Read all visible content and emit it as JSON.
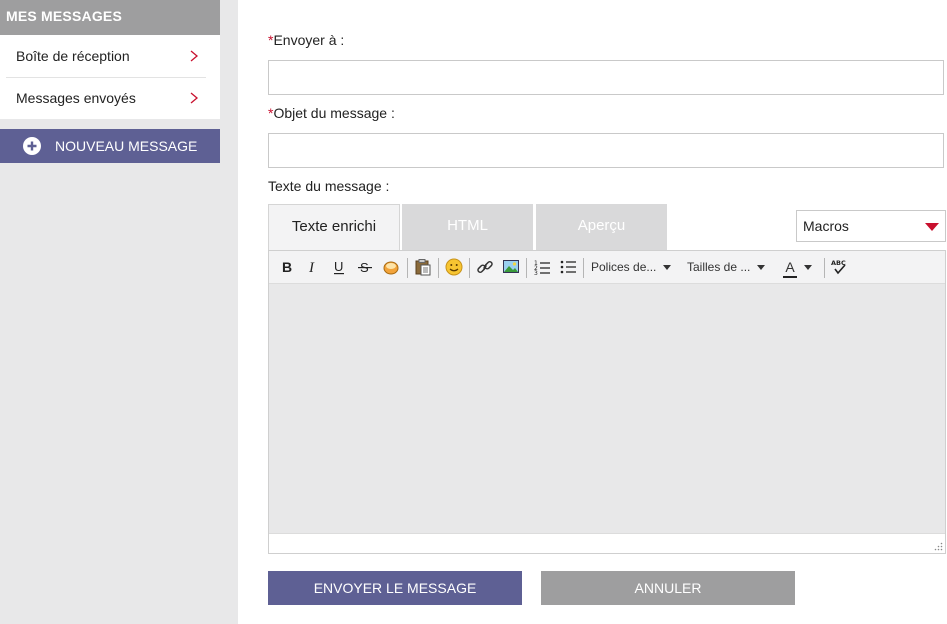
{
  "sidebar": {
    "title": "MES MESSAGES",
    "items": [
      {
        "label": "Boîte de réception"
      },
      {
        "label": "Messages envoyés"
      }
    ],
    "new_message_label": "NOUVEAU MESSAGE"
  },
  "form": {
    "required_mark": "*",
    "to_label": "Envoyer à :",
    "to_value": "",
    "subject_label": "Objet du message :",
    "subject_value": "",
    "body_label": "Texte du message :",
    "tabs": [
      {
        "label": "Texte enrichi",
        "active": true
      },
      {
        "label": "HTML",
        "active": false
      },
      {
        "label": "Aperçu",
        "active": false
      }
    ],
    "macros": {
      "selected": "Macros"
    },
    "toolbar": {
      "font_family": "Polices de...",
      "font_size": "Tailles de ...",
      "font_color_glyph": "A"
    },
    "send_label": "ENVOYER LE MESSAGE",
    "cancel_label": "ANNULER"
  },
  "colors": {
    "accent": "#5e6094",
    "required": "#c8102e",
    "header_gray": "#9e9e9f",
    "sidebar_bg": "#e8e8e9"
  }
}
